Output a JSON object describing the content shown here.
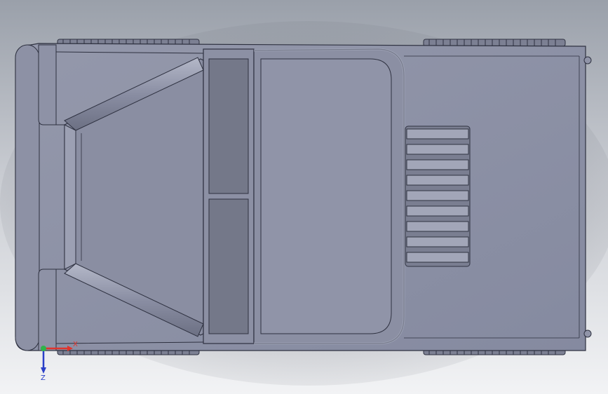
{
  "viewport": {
    "background_top": "#9aa0aa",
    "background_bottom": "#f2f3f5"
  },
  "model": {
    "body_color": "#8b8fa3",
    "body_dark": "#6f7385",
    "edge_color": "#2e3140",
    "highlight": "#a9adbf",
    "view": "top"
  },
  "triad": {
    "x_label": "X",
    "z_label": "Z",
    "x_color": "#e0342c",
    "y_color": "#2fb44a",
    "z_color": "#2a3fc8"
  }
}
